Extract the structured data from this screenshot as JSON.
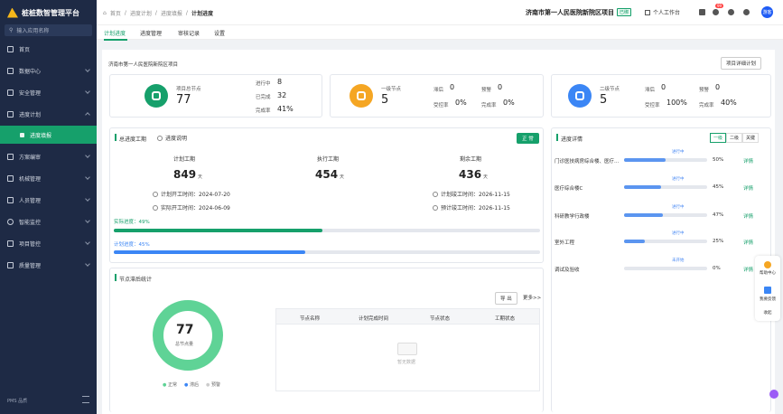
{
  "app": {
    "title": "桩桩数智管理平台"
  },
  "sidebar": {
    "search_placeholder": "输入应用名称",
    "items": [
      {
        "label": "首页"
      },
      {
        "label": "数据中心"
      },
      {
        "label": "安全管理"
      },
      {
        "label": "进度计划"
      },
      {
        "label": "进度填报"
      },
      {
        "label": "方案编审"
      },
      {
        "label": "机械管理"
      },
      {
        "label": "人员管理"
      },
      {
        "label": "智能监控"
      },
      {
        "label": "项目管控"
      },
      {
        "label": "质量管理"
      }
    ],
    "footer": "PMS 品质"
  },
  "topbar": {
    "breadcrumb": [
      "首页",
      "进度计划",
      "进度填报",
      "计划进度"
    ],
    "project_name": "济南市第一人民医院新院区项目",
    "project_badge": "已绑",
    "workspace": "个人工作台",
    "notification_count": "99",
    "avatar_text": "游客"
  },
  "tabs": [
    "计划进度",
    "进度管理",
    "审核记录",
    "设置"
  ],
  "content": {
    "project_label": "济南市第一人民医院新院区项目",
    "detail_button": "项目详细计划",
    "stat_cards": [
      {
        "label": "项目总节点",
        "value": "77",
        "color": "#16a06b",
        "kv": [
          {
            "label": "进行中",
            "value": "8"
          },
          {
            "label": "已完成",
            "value": "32"
          },
          {
            "label": "完成率",
            "value": "41%"
          }
        ]
      },
      {
        "label": "一级节点",
        "value": "5",
        "color": "#f5a623",
        "kv": [
          {
            "label": "滞后",
            "value": "0"
          },
          {
            "label": "预警",
            "value": "0"
          },
          {
            "label": "受控率",
            "value": "0%"
          },
          {
            "label": "完成率",
            "value": "0%"
          }
        ]
      },
      {
        "label": "二级节点",
        "value": "5",
        "color": "#3b86f5",
        "kv": [
          {
            "label": "滞后",
            "value": "0"
          },
          {
            "label": "预警",
            "value": "0"
          },
          {
            "label": "受控率",
            "value": "100%"
          },
          {
            "label": "完成率",
            "value": "40%"
          }
        ]
      }
    ],
    "schedule": {
      "title": "总进度工期",
      "explain": "进度说明",
      "status_button": "正 常",
      "cols": [
        {
          "label": "计划工期",
          "value": "849",
          "unit": "天"
        },
        {
          "label": "执行工期",
          "value": "454",
          "unit": "天"
        },
        {
          "label": "剩余工期",
          "value": "436",
          "unit": "天"
        }
      ],
      "dates": [
        "计划开工时间：2024-07-20",
        "实际开工时间：2024-06-09",
        "计划竣工时间：2026-11-15",
        "预计竣工时间：2026-11-15"
      ],
      "actual_label": "实际进度：49%",
      "actual_value": 0.49,
      "plan_label": "计划进度：45%",
      "plan_value": 0.45
    },
    "node_stats": {
      "title": "节点滞后统计",
      "export": "导 出",
      "more": "更多>>",
      "total": "77",
      "total_label": "总节点量",
      "legend": [
        "正常",
        "滞后",
        "预警"
      ],
      "columns": [
        "节点名称",
        "计划完成时间",
        "节点状态",
        "工期状态"
      ],
      "empty": "暂无数据"
    },
    "progress_detail": {
      "title": "进度详情",
      "levels": [
        "一级",
        "二级",
        "关键"
      ],
      "rows": [
        {
          "name": "门诊医技病房综合楼、医疗...",
          "status": "进行中",
          "pct": "50%",
          "value": 0.5,
          "link": "详情"
        },
        {
          "name": "医疗综合楼C",
          "status": "进行中",
          "pct": "45%",
          "value": 0.45,
          "link": "详情"
        },
        {
          "name": "科研教学行政楼",
          "status": "进行中",
          "pct": "47%",
          "value": 0.47,
          "link": "详情"
        },
        {
          "name": "室外工程",
          "status": "进行中",
          "pct": "25%",
          "value": 0.25,
          "link": "详情"
        },
        {
          "name": "调试及验收",
          "status": "未开始",
          "pct": "0%",
          "value": 0.0,
          "link": "详情"
        }
      ]
    }
  },
  "float_panel": [
    "帮助中心",
    "我要反馈",
    "收起"
  ],
  "colors": {
    "accent": "#16a06b",
    "blue": "#3b86f5",
    "orange": "#f5a623",
    "sidebar": "#1e2a45"
  }
}
